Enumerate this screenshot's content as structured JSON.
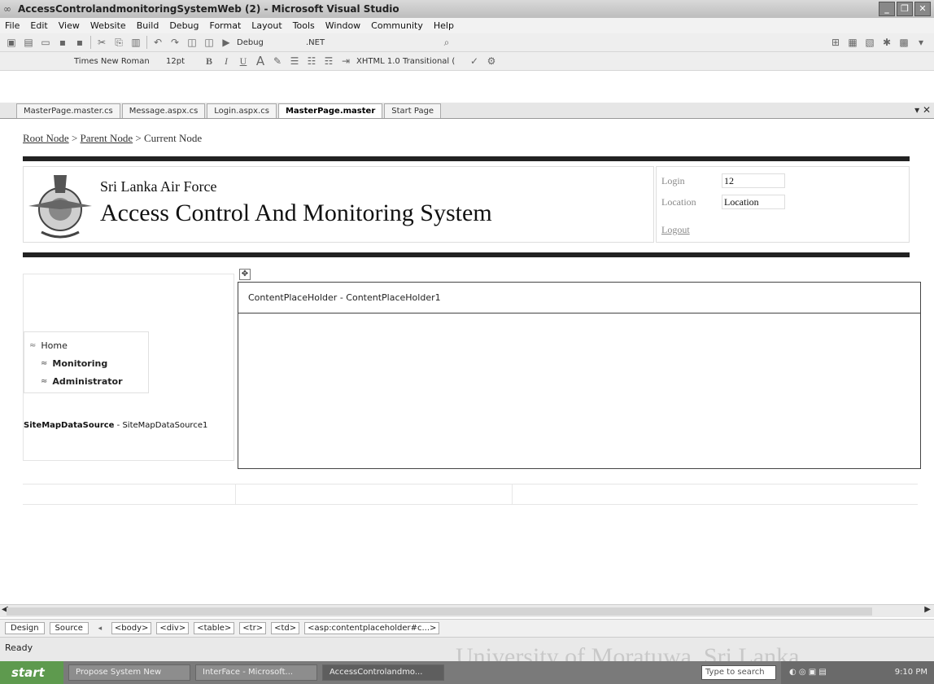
{
  "window": {
    "title": "AccessControlandmonitoringSystemWeb (2) - Microsoft Visual Studio"
  },
  "menu": [
    "File",
    "Edit",
    "View",
    "Website",
    "Build",
    "Debug",
    "Format",
    "Layout",
    "Tools",
    "Window",
    "Community",
    "Help"
  ],
  "toolbar1": {
    "config": "Debug",
    "platform": ".NET"
  },
  "toolbar2": {
    "font": "Times New Roman",
    "size": "12pt",
    "bold": "B",
    "italic": "I",
    "underline": "U",
    "doctype": "XHTML 1.0 Transitional ("
  },
  "tabs": [
    "MasterPage.master.cs",
    "Message.aspx.cs",
    "Login.aspx.cs",
    "MasterPage.master",
    "Start Page"
  ],
  "active_tab": "MasterPage.master",
  "breadcrumb": {
    "root": "Root Node",
    "parent": "Parent Node",
    "current": "Current Node",
    "sep": ">"
  },
  "header": {
    "org": "Sri Lanka Air Force",
    "system": "Access Control And Monitoring System"
  },
  "login": {
    "login_label": "Login",
    "login_value": "12",
    "location_label": "Location",
    "location_value": "Location",
    "logout": "Logout"
  },
  "nav": {
    "items": [
      "Home",
      "Monitoring",
      "Administrator"
    ]
  },
  "sitemap": {
    "type": "SiteMapDataSource",
    "id": "SiteMapDataSource1"
  },
  "placeholder": {
    "label": "ContentPlaceHolder - ContentPlaceHolder1"
  },
  "viewbar": {
    "design": "Design",
    "source": "Source",
    "tags": [
      "<body>",
      "<div>",
      "<table>",
      "<tr>",
      "<td>",
      "<asp:contentplaceholder#c...>"
    ]
  },
  "status": "Ready",
  "taskbar": {
    "start": "start",
    "tasks": [
      "Propose System New",
      "InterFace - Microsoft...",
      "AccessControlandmo..."
    ],
    "search": "Type to search",
    "clock": "9:10 PM"
  },
  "watermark": "University of Moratuwa, Sri Lanka."
}
